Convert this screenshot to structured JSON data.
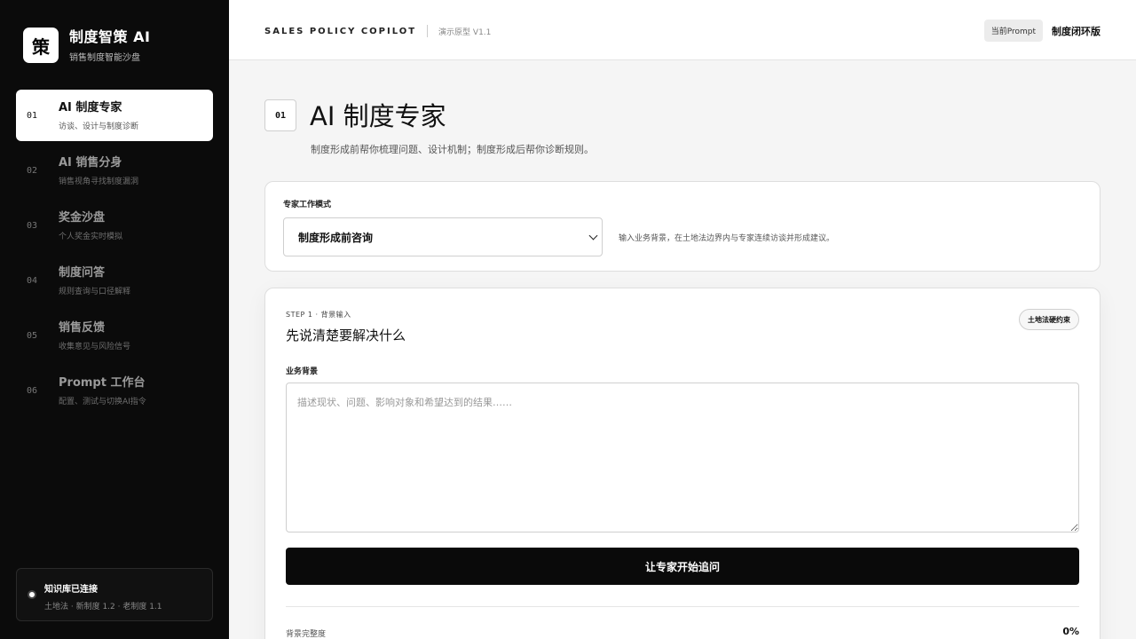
{
  "brand": {
    "logo_char": "策",
    "name": "制度智策 AI",
    "subtitle": "销售制度智能沙盘"
  },
  "sidebar": {
    "items": [
      {
        "num": "01",
        "title": "AI 制度专家",
        "desc": "访谈、设计与制度诊断"
      },
      {
        "num": "02",
        "title": "AI 销售分身",
        "desc": "销售视角寻找制度漏洞"
      },
      {
        "num": "03",
        "title": "奖金沙盘",
        "desc": "个人奖金实时模拟"
      },
      {
        "num": "04",
        "title": "制度问答",
        "desc": "规则查询与口径解释"
      },
      {
        "num": "05",
        "title": "销售反馈",
        "desc": "收集意见与风险信号"
      },
      {
        "num": "06",
        "title": "Prompt 工作台",
        "desc": "配置、测试与切换AI指令"
      }
    ],
    "kb_title": "知识库已连接",
    "kb_sub": "土地法 · 新制度 1.2 · 老制度 1.1"
  },
  "topbar": {
    "title": "SALES POLICY COPILOT",
    "version": "演示原型 V1.1",
    "prompt_chip": "当前Prompt",
    "mode": "制度闭环版"
  },
  "page": {
    "num": "01",
    "title": "AI 制度专家",
    "subtitle": "制度形成前帮你梳理问题、设计机制；制度形成后帮你诊断规则。"
  },
  "mode_card": {
    "label": "专家工作模式",
    "selected": "制度形成前咨询",
    "hint": "输入业务背景，在土地法边界内与专家连续访谈并形成建议。"
  },
  "step_card": {
    "step": "STEP 1 · 背景输入",
    "title": "先说清楚要解决什么",
    "law_chip": "土地法硬约束",
    "bg_label": "业务背景",
    "placeholder": "描述现状、问题、影响对象和希望达到的结果……",
    "cta": "让专家开始追问",
    "completeness_label": "背景完整度",
    "completeness_value": "0%"
  }
}
